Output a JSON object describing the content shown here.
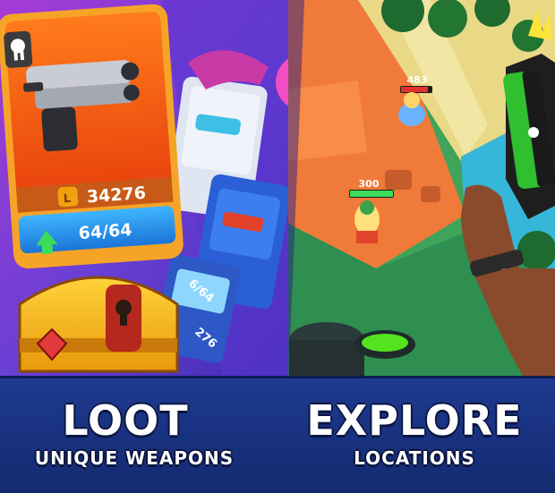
{
  "left_panel": {
    "title": "LOOT",
    "subtitle": "UNIQUE WEAPONS",
    "card": {
      "coin_value": "34276",
      "level": "64/64"
    },
    "back_cards": [
      {
        "count": "6/64"
      },
      {
        "count": "276"
      }
    ]
  },
  "right_panel": {
    "title": "EXPLORE",
    "subtitle": "LOCATIONS",
    "enemy_hp": "483",
    "player_hp": "300"
  }
}
